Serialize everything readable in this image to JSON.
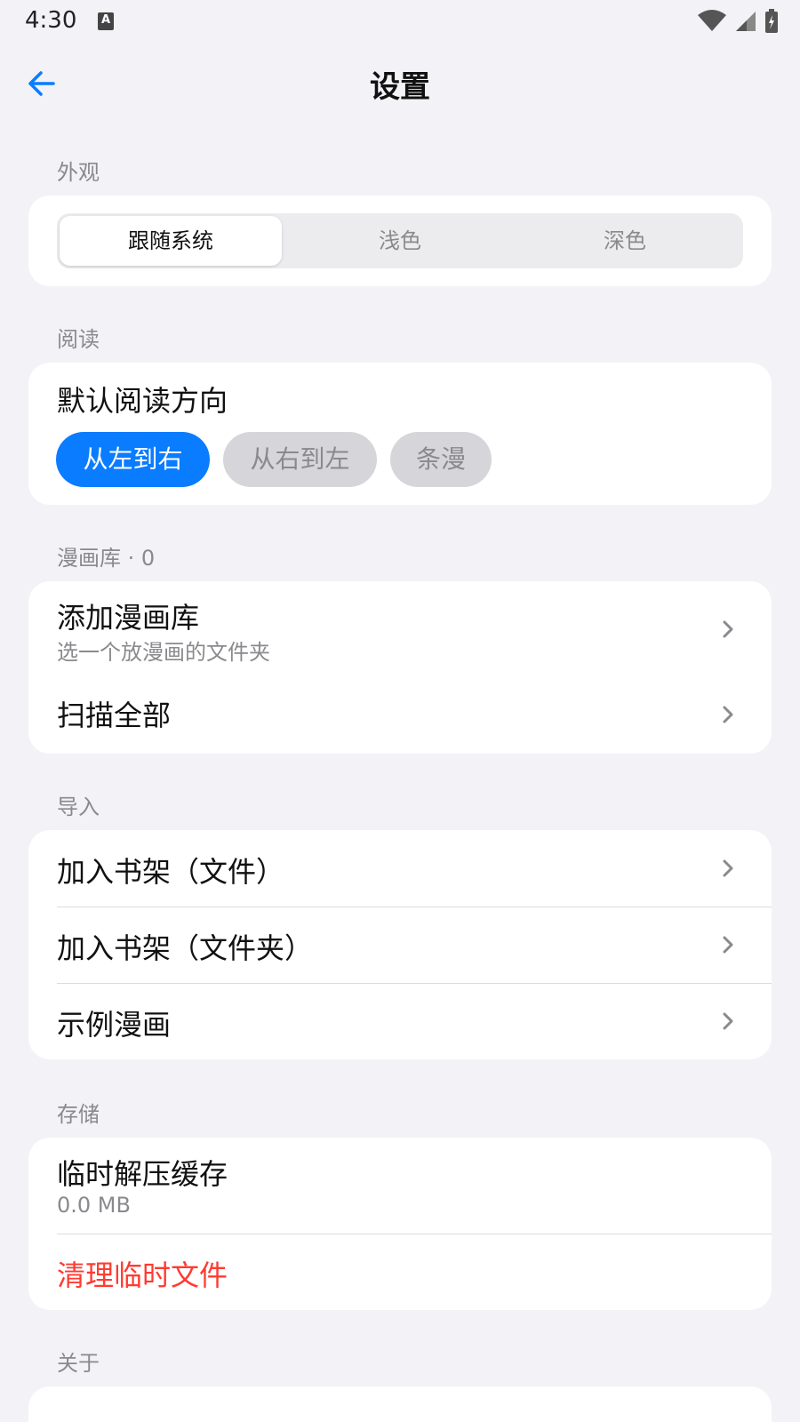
{
  "status_bar": {
    "time": "4:30",
    "notification_icon_letter": "A"
  },
  "header": {
    "title": "设置"
  },
  "appearance": {
    "section_title": "外观",
    "options": [
      "跟随系统",
      "浅色",
      "深色"
    ],
    "selected": "跟随系统"
  },
  "reading": {
    "section_title": "阅读",
    "direction_label": "默认阅读方向",
    "options": [
      "从左到右",
      "从右到左",
      "条漫"
    ],
    "selected": "从左到右"
  },
  "library": {
    "section_title": "漫画库 · 0",
    "add_title": "添加漫画库",
    "add_subtitle": "选一个放漫画的文件夹",
    "scan_title": "扫描全部"
  },
  "import": {
    "section_title": "导入",
    "items": [
      "加入书架（文件）",
      "加入书架（文件夹）",
      "示例漫画"
    ]
  },
  "storage": {
    "section_title": "存储",
    "cache_title": "临时解压缓存",
    "cache_size": "0.0 MB",
    "clear_label": "清理临时文件"
  },
  "about": {
    "section_title": "关于"
  },
  "colors": {
    "accent": "#0a7cff",
    "danger": "#ff3b30",
    "background": "#f2f2f7"
  }
}
